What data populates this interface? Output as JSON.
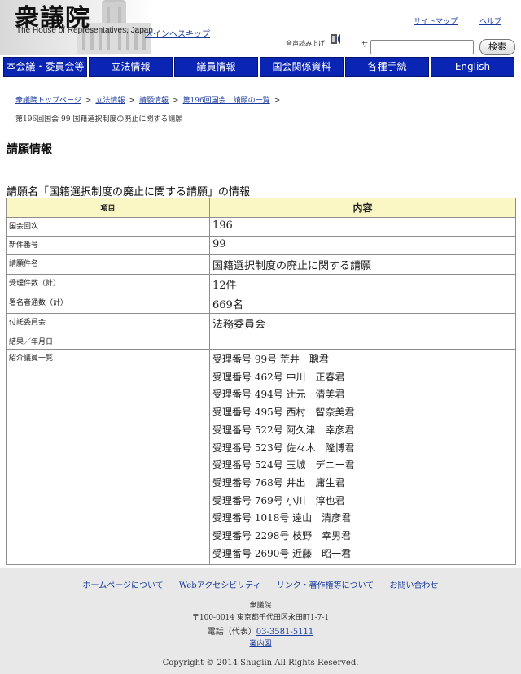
{
  "header": {
    "logo_jp": "衆議院",
    "logo_en": "The House of Representatives, Japan",
    "skip_link": "メインへスキップ",
    "sitemap": "サイトマップ",
    "help": "ヘルプ",
    "voice_label": "音声読み上げ",
    "site_label": "サ",
    "search_value": "",
    "search_button": "検索"
  },
  "nav": [
    "本会議・委員会等",
    "立法情報",
    "議員情報",
    "国会関係資料",
    "各種手続",
    "English"
  ],
  "breadcrumb": {
    "items": [
      "衆議院トップページ",
      "立法情報",
      "請願情報",
      "第196回国会　請願の一覧"
    ],
    "separator": ">",
    "current": "第196回国会 99 国籍選択制度の廃止に関する請願"
  },
  "page_title": "請願情報",
  "petition_heading": "請願名「国籍選択制度の廃止に関する請願」の情報",
  "table": {
    "headers": [
      "項目",
      "内容"
    ],
    "rows": [
      {
        "label": "国会回次",
        "value": "196"
      },
      {
        "label": "新件番号",
        "value": "99"
      },
      {
        "label": "請願件名",
        "value": "国籍選択制度の廃止に関する請願"
      },
      {
        "label": "受理件数（計）",
        "value": "12件"
      },
      {
        "label": "署名者通数（計）",
        "value": "669名"
      },
      {
        "label": "付託委員会",
        "value": "法務委員会"
      },
      {
        "label": "結果／年月日",
        "value": ""
      }
    ],
    "introducers_label": "紹介議員一覧",
    "introducers": [
      "受理番号 99号 荒井　聰君",
      "受理番号 462号 中川　正春君",
      "受理番号 494号 辻元　清美君",
      "受理番号 495号 西村　智奈美君",
      "受理番号 522号 阿久津　幸彦君",
      "受理番号 523号 佐々木　隆博君",
      "受理番号 524号 玉城　デニー君",
      "受理番号 768号 井出　庸生君",
      "受理番号 769号 小川　淳也君",
      "受理番号 1018号 遠山　清彦君",
      "受理番号 2298号 枝野　幸男君",
      "受理番号 2690号 近藤　昭一君"
    ]
  },
  "footer": {
    "links": [
      "ホームページについて",
      "Webアクセシビリティ",
      "リンク・著作権等について",
      "お問い合わせ"
    ],
    "org": "衆議院",
    "address": "〒100-0014 東京都千代田区永田町1-7-1",
    "tel_label": "電話（代表）",
    "tel_number": "03-3581-5111",
    "map": "案内図",
    "copyright": "Copyright © 2014 Shugiin All Rights Reserved."
  },
  "colors": {
    "nav_bg": "#0a24b3",
    "link": "#1a3a9c",
    "table_header_bg": "#fbf7c4",
    "footer_bg": "#e8e8e8"
  }
}
